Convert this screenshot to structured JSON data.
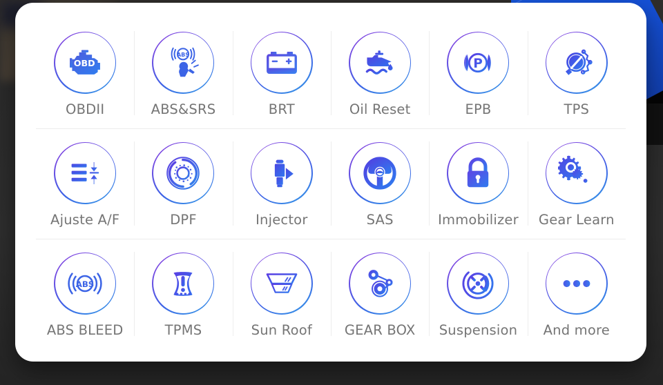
{
  "background": {
    "color": "#2b2b2b",
    "banner_color": "#1550d6",
    "banner_dark": "#050505"
  },
  "card": {
    "background": "#ffffff",
    "accent_gradient_start": "#8b3fe0",
    "accent_gradient_end": "#38a0e8",
    "icon_color": "#3c64e6",
    "label_color": "#757575",
    "divider_color": "#ececec"
  },
  "grid": {
    "columns": 6,
    "rows": [
      [
        {
          "label": "OBDII",
          "icon": "engine-obd-icon"
        },
        {
          "label": "ABS&SRS",
          "icon": "abs-srs-airbag-icon"
        },
        {
          "label": "BRT",
          "icon": "battery-icon"
        },
        {
          "label": "Oil Reset",
          "icon": "oil-can-icon"
        },
        {
          "label": "EPB",
          "icon": "parking-brake-icon"
        },
        {
          "label": "TPS",
          "icon": "throttle-body-icon"
        }
      ],
      [
        {
          "label": "Ajuste A/F",
          "icon": "air-fuel-adjust-icon"
        },
        {
          "label": "DPF",
          "icon": "dpf-filter-icon"
        },
        {
          "label": "Injector",
          "icon": "injector-icon"
        },
        {
          "label": "SAS",
          "icon": "steering-wheel-icon"
        },
        {
          "label": "Immobilizer",
          "icon": "lock-icon"
        },
        {
          "label": "Gear Learn",
          "icon": "gears-icon"
        }
      ],
      [
        {
          "label": "ABS BLEED",
          "icon": "abs-bleed-icon"
        },
        {
          "label": "TPMS",
          "icon": "tire-pressure-icon"
        },
        {
          "label": "Sun Roof",
          "icon": "sunroof-icon"
        },
        {
          "label": "GEAR BOX",
          "icon": "gearbox-belt-icon"
        },
        {
          "label": "Suspension",
          "icon": "suspension-wheel-icon"
        },
        {
          "label": "And more",
          "icon": "ellipsis-icon"
        }
      ]
    ]
  }
}
